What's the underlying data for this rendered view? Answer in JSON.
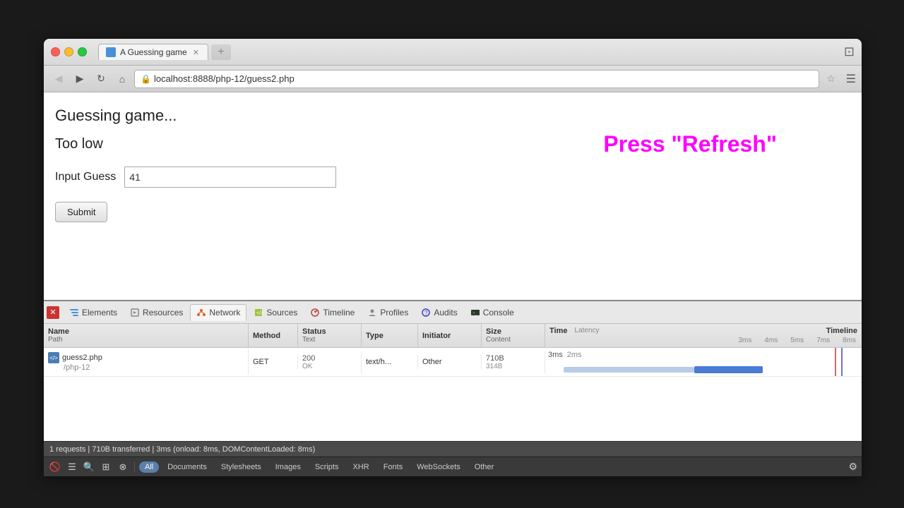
{
  "browser": {
    "tab_title": "A Guessing game",
    "url": "localhost:8888/php-12/guess2.php",
    "new_tab_placeholder": "+"
  },
  "page": {
    "title": "Guessing game...",
    "feedback": "Too low",
    "form_label": "Input Guess",
    "input_value": "41",
    "submit_label": "Submit",
    "press_refresh": "Press \"Refresh\""
  },
  "devtools": {
    "tabs": [
      {
        "id": "elements",
        "label": "Elements"
      },
      {
        "id": "resources",
        "label": "Resources"
      },
      {
        "id": "network",
        "label": "Network"
      },
      {
        "id": "sources",
        "label": "Sources"
      },
      {
        "id": "timeline",
        "label": "Timeline"
      },
      {
        "id": "profiles",
        "label": "Profiles"
      },
      {
        "id": "audits",
        "label": "Audits"
      },
      {
        "id": "console",
        "label": "Console"
      }
    ],
    "active_tab": "network",
    "network": {
      "columns": {
        "name": "Name",
        "path": "Path",
        "method": "Method",
        "status": "Status",
        "status_sub": "Text",
        "type": "Type",
        "initiator": "Initiator",
        "size": "Size",
        "size_sub": "Content",
        "time": "Time",
        "time_sub": "Latency",
        "timeline": "Timeline"
      },
      "timeline_ticks": [
        "3ms",
        "4ms",
        "5ms",
        "7ms",
        "8ms"
      ],
      "rows": [
        {
          "name": "guess2.php",
          "path": "/php-12",
          "method": "GET",
          "status": "200",
          "status_text": "OK",
          "type": "text/h...",
          "initiator": "Other",
          "size": "710B",
          "size_content": "314B",
          "time": "3ms",
          "time_latency": "2ms"
        }
      ]
    },
    "status_bar": "1 requests  |  710B transferred  |  3ms (onload: 8ms, DOMContentLoaded: 8ms)",
    "filter_buttons": [
      "All",
      "Documents",
      "Stylesheets",
      "Images",
      "Scripts",
      "XHR",
      "Fonts",
      "WebSockets",
      "Other"
    ]
  }
}
